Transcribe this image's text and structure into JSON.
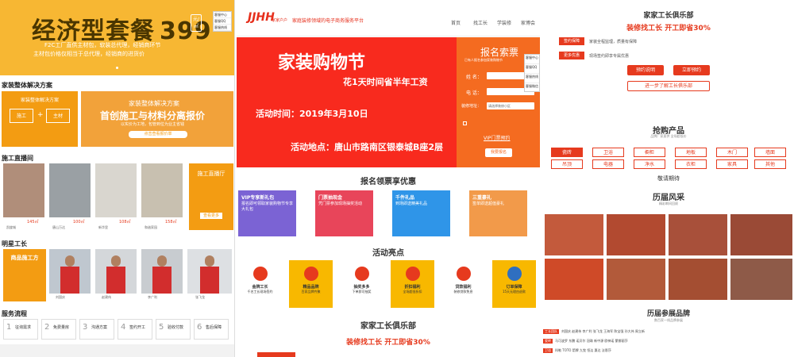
{
  "panel1": {
    "banner_title": "经济型套餐",
    "banner_price": "399",
    "banner_unit": "元/㎡",
    "banner_sub1": "F2C工厂直供主材包，软装总代理，经销商环节",
    "banner_sub2": "主材包价格仅相当于总代理，经销商的进货价",
    "float_items": [
      "客服中心",
      "客服QQ",
      "客服热线"
    ],
    "section1": "家装整体解决方案",
    "sol_card_title": "家装整体解决方案",
    "sol_left1": "施工",
    "sol_left2": "主材",
    "sol_right_title": "家装整体解决方案",
    "sol_right_big": "首创施工与材料分离报价",
    "sol_right_sub": "以实价为工地，包管到位为业主省钱",
    "sol_right_btn": "点击查看报价单",
    "section2": "施工直播间",
    "live_side_title": "施工直播厅",
    "live_side_btn": "查看更多",
    "live_items": [
      {
        "area": "145㎡",
        "caption": "凯旋城"
      },
      {
        "area": "100㎡",
        "caption": "唐山万达"
      },
      {
        "area": "108㎡",
        "caption": "新华里"
      },
      {
        "area": "158㎡",
        "caption": "和谐家园"
      }
    ],
    "section3": "明星工长",
    "star_side_title": "商品施工方",
    "star_names": [
      "刘国庆",
      "赵建伟",
      "李广利",
      "张飞龙"
    ],
    "section4": "服务流程",
    "steps": [
      {
        "num": "1",
        "label": "征询需求"
      },
      {
        "num": "2",
        "label": "免费量房"
      },
      {
        "num": "3",
        "label": "沟通方案"
      },
      {
        "num": "4",
        "label": "签约开工"
      },
      {
        "num": "5",
        "label": "验收付款"
      },
      {
        "num": "6",
        "label": "售后保障"
      }
    ]
  },
  "panel2": {
    "logo": "JJHH",
    "logo_small": "家家户户",
    "logo_sub": "家庭装修领域的电子商务服务平台",
    "nav": [
      "首页",
      "找工长",
      "学装修",
      "家博会"
    ],
    "ban_title": "家装购物节",
    "ban_sub": "花1天时间省半年工资",
    "ban_time": "活动时间：2019年3月10日",
    "ban_place": "活动地点：唐山市路南区银泰城B座2层",
    "reg_title": "报名索票",
    "reg_sub": "已有人报名参加家装购物节",
    "reg_name": "姓 名：",
    "reg_phone": "电 话：",
    "reg_addr": "装修地址：",
    "reg_addr_value": "请选择装修小区",
    "reg_vip": "VIP门票预约",
    "reg_btn": "我要报名",
    "float_items": [
      "客服中心",
      "客服QQ",
      "客服热线",
      "客服微信"
    ],
    "coupon_title": "报名领票享优惠",
    "coupons": [
      {
        "title": "VIP专享新礼包",
        "sub": "报名即可领取家装购物节专享大礼包",
        "color": "#7b63d4"
      },
      {
        "title": "门票抽现金",
        "sub": "凭门票参加现场抽奖活动",
        "color": "#e8455a"
      },
      {
        "title": "千件礼品",
        "sub": "到场即送精美礼品",
        "color": "#2f95e8"
      },
      {
        "title": "三重豪礼",
        "sub": "签单即送超值豪礼",
        "color": "#f29a4a"
      }
    ],
    "hl_title": "活动亮点",
    "highlights": [
      {
        "title": "金牌工长",
        "sub": "千名工长现场签约"
      },
      {
        "title": "精品品牌",
        "sub": "百家品牌齐聚"
      },
      {
        "title": "抽奖多多",
        "sub": "下单即可抽奖"
      },
      {
        "title": "折扣福利",
        "sub": "全场超低折扣"
      },
      {
        "title": "贷款福利",
        "sub": "装修贷款免息"
      },
      {
        "title": "订单保障",
        "sub": "15天无理由退款"
      }
    ],
    "club_title": "家家工长俱乐部",
    "club_sub": "装修找工长 开工即省30%"
  },
  "panel3": {
    "club_title": "家家工长俱乐部",
    "club_sub": "装修找工长 开工即省30%",
    "tag1": "签约保障",
    "tag1_text": "家装全程监理，质量有保障",
    "tag2": "更多优惠",
    "tag2_text": "现场签约即享专属优惠",
    "btn1": "预约说明",
    "btn2": "立即预约",
    "btn3": "进一步了解工长俱乐部",
    "grab_title": "抢购产品",
    "grab_sub": "品牌厂家直供 全场超低价",
    "products": [
      "瓷砖",
      "卫浴",
      "橱柜",
      "地板",
      "木门",
      "墙面",
      "吊顶",
      "电器",
      "净水",
      "衣柜",
      "家具",
      "其他"
    ],
    "selected_product": "瓷砖",
    "hint": "敬请期待",
    "past_title": "历届风采",
    "past_sub": "精彩瞬间回顾",
    "brand_title": "历届参展品牌",
    "brand_sub": "数百家一线品牌参展",
    "brand_rows": [
      {
        "tag": "工长团队",
        "text": "刘国庆 赵建伟 李广利 张飞龙 王海军 陈宝强 孙大伟 周立新"
      },
      {
        "tag": "瓷砖",
        "text": "马可波罗 东鹏 诺贝尔 冠珠 新中源 欧神诺 蒙娜丽莎"
      },
      {
        "tag": "卫浴",
        "text": "科勒 TOTO 箭牌 九牧 恒洁 惠达 法恩莎"
      }
    ],
    "colors": {
      "accent": "#e63a1e",
      "orange": "#f39c12"
    }
  }
}
